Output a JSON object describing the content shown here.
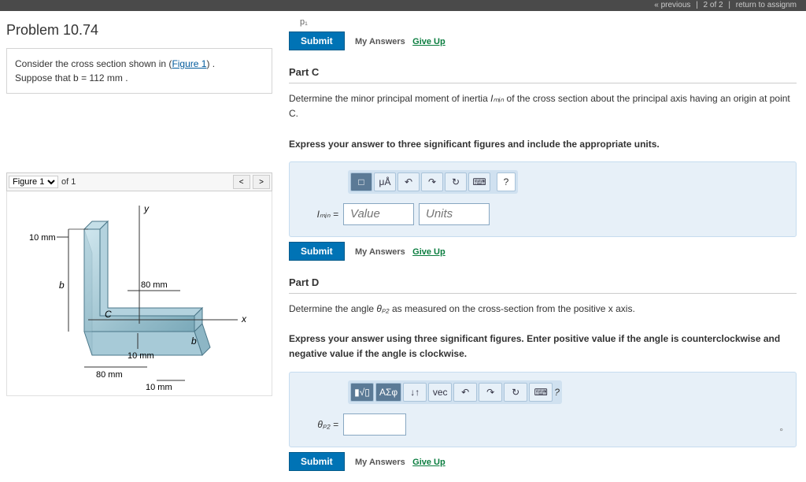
{
  "topbar": {
    "prev": "« previous",
    "pager": "2 of 2",
    "retn": "return to assignm"
  },
  "problem": {
    "title": "Problem 10.74",
    "prompt_pre": "Consider the cross section shown in (",
    "figlink": "Figure 1",
    "prompt_post": ") .",
    "suppose": "Suppose that b = 112  mm ."
  },
  "figure": {
    "label": "Figure 1",
    "of": "of 1",
    "dims": {
      "ten1": "10 mm",
      "eighty1": "80 mm",
      "eighty2": "80 mm",
      "ten2": "10 mm",
      "ten3": "10 mm",
      "b1": "b",
      "b2": "b",
      "C": "C",
      "x": "x",
      "y": "y"
    }
  },
  "partB": {
    "submit": "Submit",
    "my": "My Answers",
    "give": "Give Up",
    "pi": "p₁"
  },
  "partC": {
    "header": "Part C",
    "text1_pre": "Determine the minor principal moment of inertia ",
    "imin_sym": "Iₘᵢₙ",
    "text1_post": " of the cross section about the principal axis having an origin at point C.",
    "text2": "Express your answer to three significant figures and include the appropriate units.",
    "tool": {
      "frac": "□",
      "ua": "μÅ",
      "undo": "↶",
      "redo": "↷",
      "reset": "↻",
      "kbd": "⌨",
      "help": "?"
    },
    "lbl": "Iₘᵢₙ =",
    "value_ph": "Value",
    "units_ph": "Units",
    "submit": "Submit",
    "my": "My Answers",
    "give": "Give Up"
  },
  "partD": {
    "header": "Part D",
    "text1_pre": "Determine the angle ",
    "theta_sym": "θₚ₂",
    "text1_post": " as measured on the cross-section from the positive x axis.",
    "text2": "Express your answer using three significant figures. Enter positive value if the angle is counterclockwise and negative value if the angle is clockwise.",
    "tool": {
      "tmpl": "▮√▯",
      "greek": "ΑΣφ",
      "updn": "↓↑",
      "vec": "vec",
      "undo": "↶",
      "redo": "↷",
      "reset": "↻",
      "kbd": "⌨",
      "help": "?"
    },
    "lbl": "θₚ₂ =",
    "deg": "°",
    "submit": "Submit",
    "my": "My Answers",
    "give": "Give Up"
  }
}
